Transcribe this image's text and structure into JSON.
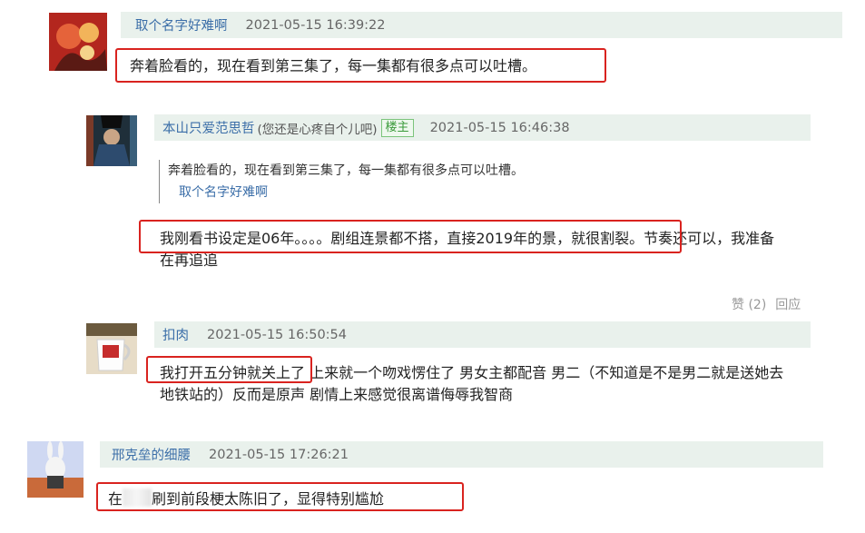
{
  "comments": [
    {
      "username": "取个名字好难啊",
      "time": "2021-05-15 16:39:22",
      "text": "奔着脸看的，现在看到第三集了，每一集都有很多点可以吐槽。"
    },
    {
      "username": "本山只爱范思哲",
      "subtitle": "(您还是心疼自个儿吧)",
      "badge": "楼主",
      "time": "2021-05-15 16:46:38",
      "quote_text": "奔着脸看的，现在看到第三集了，每一集都有很多点可以吐槽。",
      "quote_author": "取个名字好难啊",
      "text_line1": "我刚看书设定是06年。。。。剧组连景都不搭，直接2019年的景，就很割裂。节奏还可以，我准备",
      "text_line2": "在再追追",
      "like_label": "赞 (2)",
      "reply_label": "回应"
    },
    {
      "username": "扣肉",
      "time": "2021-05-15 16:50:54",
      "text_line1": "我打开五分钟就关上了 上来就一个吻戏愣住了 男女主都配音 男二（不知道是不是男二就是送她去",
      "text_line2": "地铁站的）反而是原声 剧情上来感觉很离谱侮辱我智商"
    },
    {
      "username": "邢克垒的细腰",
      "time": "2021-05-15 17:26:21",
      "text_before": "在",
      "text_after": "刷到前段梗太陈旧了，显得特别尴尬"
    }
  ],
  "colors": {
    "header_bg": "#e9f1ec",
    "link": "#3b6ea8",
    "highlight_box": "#d9231f",
    "badge": "#3a9a3a"
  }
}
